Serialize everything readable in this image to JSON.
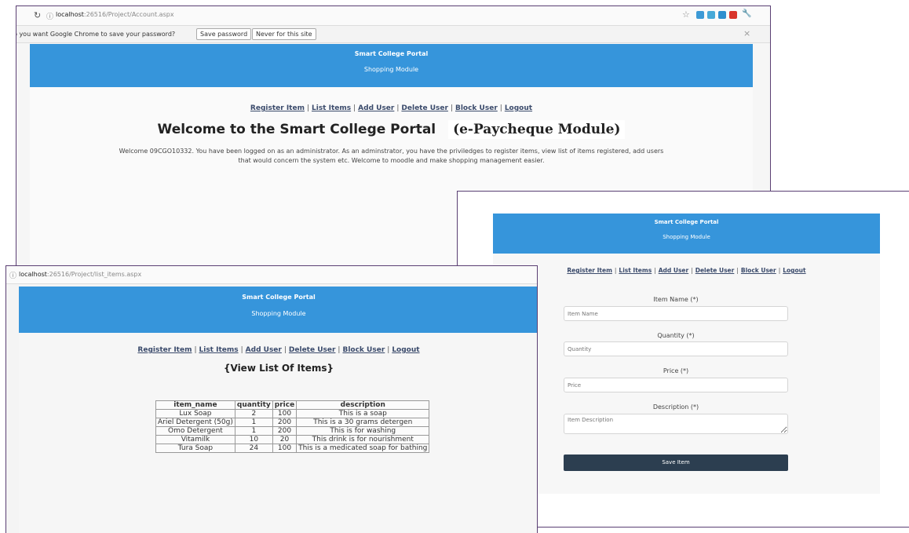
{
  "win1": {
    "url_host": "localhost",
    "url_rest": ":26516/Project/Account.aspx",
    "infobar": {
      "message": "o you want Google Chrome to save your password?",
      "save_label": "Save password",
      "never_label": "Never for this site",
      "close": "×"
    },
    "banner": {
      "title": "Smart College Portal",
      "subtitle": "Shopping Module"
    },
    "welcome_title": "Welcome to the Smart College Portal",
    "welcome_module": "(e-Paycheque Module)",
    "welcome_line1": "Welcome 09CGO10332. You have been logged on as an administrator. As an adminstrator, you have the priviledges to register items, view list of items registered, add users",
    "welcome_line2": "that would concern the system etc. Welcome to moodle and make shopping management easier."
  },
  "nav": {
    "register": "Register Item",
    "list": "List Items",
    "add": "Add User",
    "delete": "Delete User",
    "block": "Block User",
    "logout": "Logout",
    "sep": "|"
  },
  "win2": {
    "url_host": "localhost",
    "url_rest": ":26516/Project/list_items.aspx",
    "banner": {
      "title": "Smart College Portal",
      "subtitle": "Shopping Module"
    },
    "heading": "{View List Of Items}",
    "table": {
      "headers": [
        "item_name",
        "quantity",
        "price",
        "description"
      ],
      "rows": [
        [
          "Lux Soap",
          "2",
          "100",
          "This is a soap"
        ],
        [
          "Ariel Detergent (50g)",
          "1",
          "200",
          "This is a 30 grams detergen"
        ],
        [
          "Omo Detergent",
          "1",
          "200",
          "This is for washing"
        ],
        [
          "Vitamilk",
          "10",
          "20",
          "This drink is for nourishment"
        ],
        [
          "Tura Soap",
          "24",
          "100",
          "This is a medicated soap for bathing"
        ]
      ]
    }
  },
  "win3": {
    "banner": {
      "title": "Smart College Portal",
      "subtitle": "Shopping Module"
    },
    "item_name_label": "Item Name  (*)",
    "item_name_placeholder": "Item Name",
    "quantity_label": "Quantity  (*)",
    "quantity_placeholder": "Quantity",
    "price_label": "Price  (*)",
    "price_placeholder": "Price",
    "description_label": "Description (*)",
    "description_placeholder": "Item Description",
    "save_label": "Save Item"
  },
  "colors": {
    "banner": "#3695db",
    "button": "#2c3e50",
    "frame": "#5a3f73",
    "link": "#3a4a6b"
  },
  "icons": [
    "reload-icon",
    "page-info-icon",
    "star-icon",
    "extension-icon",
    "wrench-icon"
  ]
}
